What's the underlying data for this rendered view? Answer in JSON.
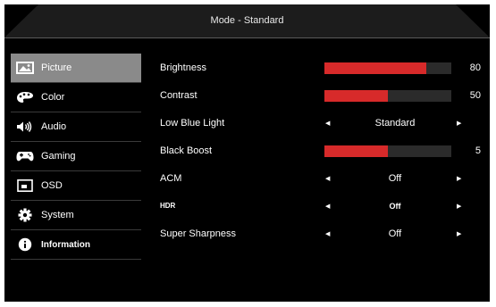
{
  "header": {
    "title": "Mode - Standard"
  },
  "sidebar": {
    "items": [
      {
        "label": "Picture",
        "icon": "picture-icon",
        "active": true
      },
      {
        "label": "Color",
        "icon": "palette-icon"
      },
      {
        "label": "Audio",
        "icon": "speaker-icon"
      },
      {
        "label": "Gaming",
        "icon": "gamepad-icon"
      },
      {
        "label": "OSD",
        "icon": "osd-window-icon"
      },
      {
        "label": "System",
        "icon": "gear-icon"
      },
      {
        "label": "Information",
        "icon": "info-icon"
      }
    ]
  },
  "settings": {
    "brightness": {
      "label": "Brightness",
      "value": "80",
      "level": 0.8
    },
    "contrast": {
      "label": "Contrast",
      "value": "50",
      "level": 0.5
    },
    "low_blue_light": {
      "label": "Low Blue Light",
      "value": "Standard"
    },
    "black_boost": {
      "label": "Black Boost",
      "value": "5",
      "level": 0.5
    },
    "acm": {
      "label": "ACM",
      "value": "Off"
    },
    "hdr": {
      "label": "HDR",
      "value": "Off"
    },
    "super_sharpness": {
      "label": "Super Sharpness",
      "value": "Off"
    }
  },
  "colors": {
    "accent": "#d72a2a",
    "active_bg": "#8a8a8a",
    "bar_track": "#2b2b2b"
  }
}
